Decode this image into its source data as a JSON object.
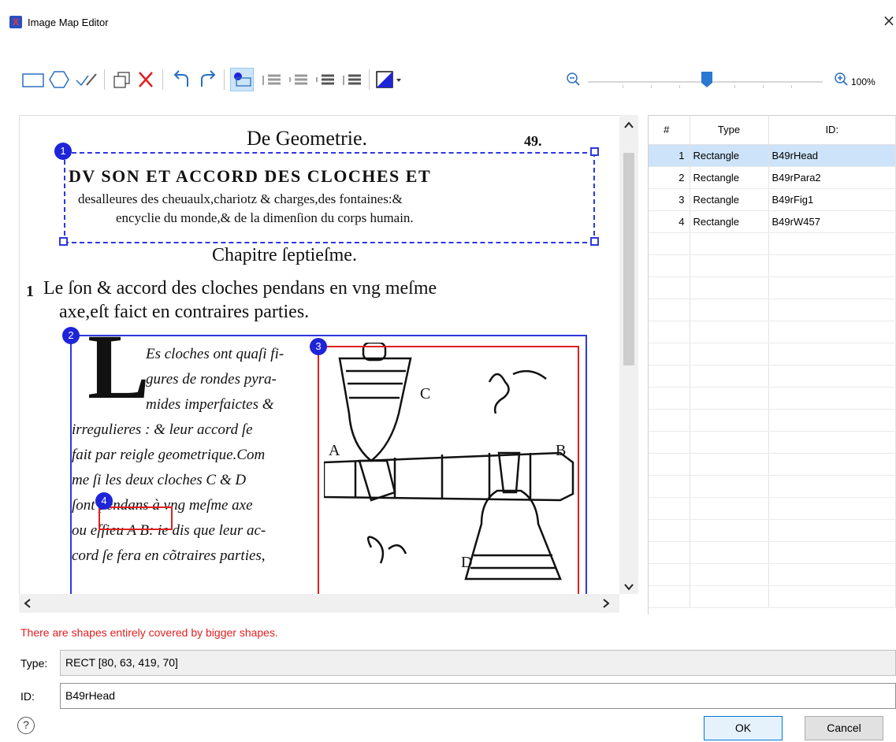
{
  "window": {
    "title": "Image Map Editor",
    "close_glyph": "×"
  },
  "toolbar": {
    "tools": [
      "rectangle-tool",
      "polygon-tool",
      "edit-points-tool",
      "duplicate-tool",
      "delete-tool",
      "undo-tool",
      "redo-tool",
      "show-numbers-toggle",
      "bring-to-front",
      "bring-forward",
      "send-backward",
      "send-to-back",
      "shape-color-picker",
      "zoom-out",
      "zoom-in"
    ],
    "zoom_label": "100%",
    "zoom_level": 0.5
  },
  "page": {
    "header_title": "De Geometrie.",
    "page_number": "49.",
    "heading_line1": "DV SON ET ACCORD DES CLOCHES ET",
    "heading_line2": "desalleures des cheuaulx,chariotz & charges,des fontaines:&",
    "heading_line3": "encyclie du monde,& de la dimenſion du corps humain.",
    "chapter": "Chapitre ſeptieſme.",
    "para_marker": "1",
    "para_line1": "Le ſon & accord des cloches pendans en vng meſme",
    "para_line2": "axe,eſt faict en contraires parties.",
    "drop_cap": "L",
    "body_lines": [
      "Es cloches ont quaſi fi-",
      "gures de rondes pyra-",
      "mides imperfaictes &",
      "irregulieres : & leur accord ſe",
      "fait par reigle geometrique.Com",
      "me ſi les deux cloches C & D",
      "ſont pendans à vng meſme axe",
      "ou eſſieu A B: ie dis que leur ac-",
      "cord ſe fera en cõtraires parties,"
    ],
    "figure_labels": [
      "C",
      "A",
      "B",
      "D"
    ]
  },
  "shapes": [
    {
      "number": "1",
      "color": "#2d38e0",
      "style": "dashed"
    },
    {
      "number": "2",
      "color": "#2d38e0",
      "style": "solid"
    },
    {
      "number": "3",
      "color": "#e02020",
      "style": "solid"
    },
    {
      "number": "4",
      "color": "#e02020",
      "style": "solid"
    }
  ],
  "table": {
    "headers": [
      "#",
      "Type",
      "ID:"
    ],
    "rows": [
      {
        "num": "1",
        "type": "Rectangle",
        "id": "B49rHead"
      },
      {
        "num": "2",
        "type": "Rectangle",
        "id": "B49rPara2"
      },
      {
        "num": "3",
        "type": "Rectangle",
        "id": "B49rFig1"
      },
      {
        "num": "4",
        "type": "Rectangle",
        "id": "B49rW457"
      }
    ]
  },
  "status": {
    "warning": "There are shapes entirely covered by bigger shapes."
  },
  "fields": {
    "type_label": "Type:",
    "type_value": "RECT [80, 63, 419, 70]",
    "id_label": "ID:",
    "id_value": "B49rHead"
  },
  "buttons": {
    "ok": "OK",
    "cancel": "Cancel",
    "help": "?"
  }
}
